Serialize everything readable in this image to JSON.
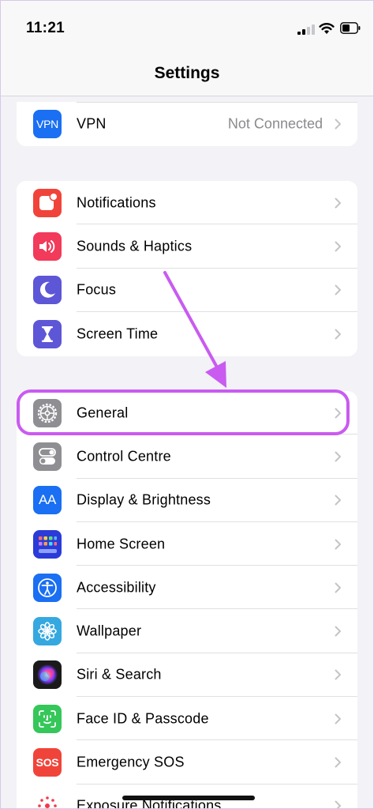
{
  "status_bar": {
    "time": "11:21"
  },
  "nav": {
    "title": "Settings"
  },
  "groups": {
    "vpn": {
      "items": [
        {
          "label": "VPN",
          "value": "Not Connected",
          "icon": "vpn-icon",
          "color": "#1a6ff2",
          "icon_text": "VPN"
        }
      ]
    },
    "notifications": {
      "items": [
        {
          "label": "Notifications",
          "icon": "bell-icon",
          "color": "#f0443a"
        },
        {
          "label": "Sounds & Haptics",
          "icon": "speaker-icon",
          "color": "#f23a5a"
        },
        {
          "label": "Focus",
          "icon": "moon-icon",
          "color": "#5d56d6"
        },
        {
          "label": "Screen Time",
          "icon": "hourglass-icon",
          "color": "#5d56d6"
        }
      ]
    },
    "general": {
      "items": [
        {
          "label": "General",
          "icon": "gear-icon",
          "color": "#8e8e93"
        },
        {
          "label": "Control Centre",
          "icon": "toggles-icon",
          "color": "#8e8e93"
        },
        {
          "label": "Display & Brightness",
          "icon": "text-size-icon",
          "color": "#1a6ff2",
          "icon_text": "AA"
        },
        {
          "label": "Home Screen",
          "icon": "app-grid-icon",
          "color": "#2b3bd8"
        },
        {
          "label": "Accessibility",
          "icon": "accessibility-icon",
          "color": "#1a6ff2"
        },
        {
          "label": "Wallpaper",
          "icon": "flower-icon",
          "color": "#35a8e0"
        },
        {
          "label": "Siri & Search",
          "icon": "siri-icon",
          "color": "#1a1a1a"
        },
        {
          "label": "Face ID & Passcode",
          "icon": "face-id-icon",
          "color": "#35c759"
        },
        {
          "label": "Emergency SOS",
          "icon": "sos-icon",
          "color": "#f0443a",
          "icon_text": "SOS"
        },
        {
          "label": "Exposure Notifications",
          "icon": "exposure-icon",
          "color": "#ffffff"
        }
      ]
    }
  },
  "annotation": {
    "highlight_color": "#c95bf0"
  }
}
